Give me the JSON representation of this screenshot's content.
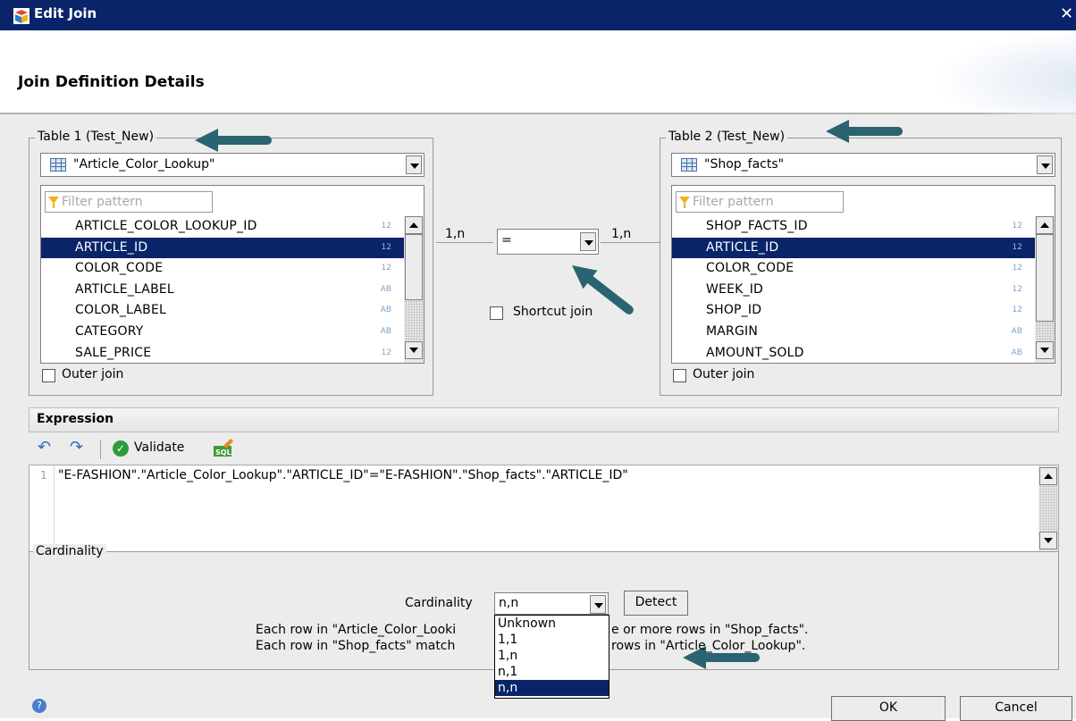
{
  "window": {
    "title": "Edit Join"
  },
  "header": {
    "title": "Join Definition Details"
  },
  "table1": {
    "group_label": "Table 1 (Test_New)",
    "selected_table": "\"Article_Color_Lookup\"",
    "filter_placeholder": "Filter pattern",
    "columns": [
      {
        "name": "ARTICLE_COLOR_LOOKUP_ID",
        "type": "12"
      },
      {
        "name": "ARTICLE_ID",
        "type": "12"
      },
      {
        "name": "COLOR_CODE",
        "type": "12"
      },
      {
        "name": "ARTICLE_LABEL",
        "type": "AB"
      },
      {
        "name": "COLOR_LABEL",
        "type": "AB"
      },
      {
        "name": "CATEGORY",
        "type": "AB"
      },
      {
        "name": "SALE_PRICE",
        "type": "12"
      }
    ],
    "selected_column": "ARTICLE_ID",
    "outer_join_label": "Outer join"
  },
  "table2": {
    "group_label": "Table 2 (Test_New)",
    "selected_table": "\"Shop_facts\"",
    "filter_placeholder": "Filter pattern",
    "columns": [
      {
        "name": "SHOP_FACTS_ID",
        "type": "12"
      },
      {
        "name": "ARTICLE_ID",
        "type": "12"
      },
      {
        "name": "COLOR_CODE",
        "type": "12"
      },
      {
        "name": "WEEK_ID",
        "type": "12"
      },
      {
        "name": "SHOP_ID",
        "type": "12"
      },
      {
        "name": "MARGIN",
        "type": "AB"
      },
      {
        "name": "AMOUNT_SOLD",
        "type": "AB"
      }
    ],
    "selected_column": "ARTICLE_ID",
    "outer_join_label": "Outer join"
  },
  "join": {
    "left_cardinality": "1,n",
    "operator": "=",
    "right_cardinality": "1,n",
    "shortcut_label": "Shortcut join"
  },
  "expression": {
    "title": "Expression",
    "validate_label": "Validate",
    "line_number": "1",
    "text": "\"E-FASHION\".\"Article_Color_Lookup\".\"ARTICLE_ID\"=\"E-FASHION\".\"Shop_facts\".\"ARTICLE_ID\""
  },
  "cardinality": {
    "group_label": "Cardinality",
    "label": "Cardinality",
    "value": "n,n",
    "detect_label": "Detect",
    "line1_left": "Each row in \"Article_Color_Looki",
    "line1_right": "e or more rows in \"Shop_facts\".",
    "line2_left": "Each row in \"Shop_facts\" match",
    "line2_right": "rows in \"Article_Color_Lookup\".",
    "options": [
      "Unknown",
      "1,1",
      "1,n",
      "n,1",
      "n,n"
    ],
    "selected_option": "n,n"
  },
  "footer": {
    "ok_label": "OK",
    "cancel_label": "Cancel"
  },
  "colors": {
    "titlebar": "#0a246a",
    "selection": "#0a246a",
    "arrow": "#2a6470",
    "dialog_bg": "#ececec"
  }
}
